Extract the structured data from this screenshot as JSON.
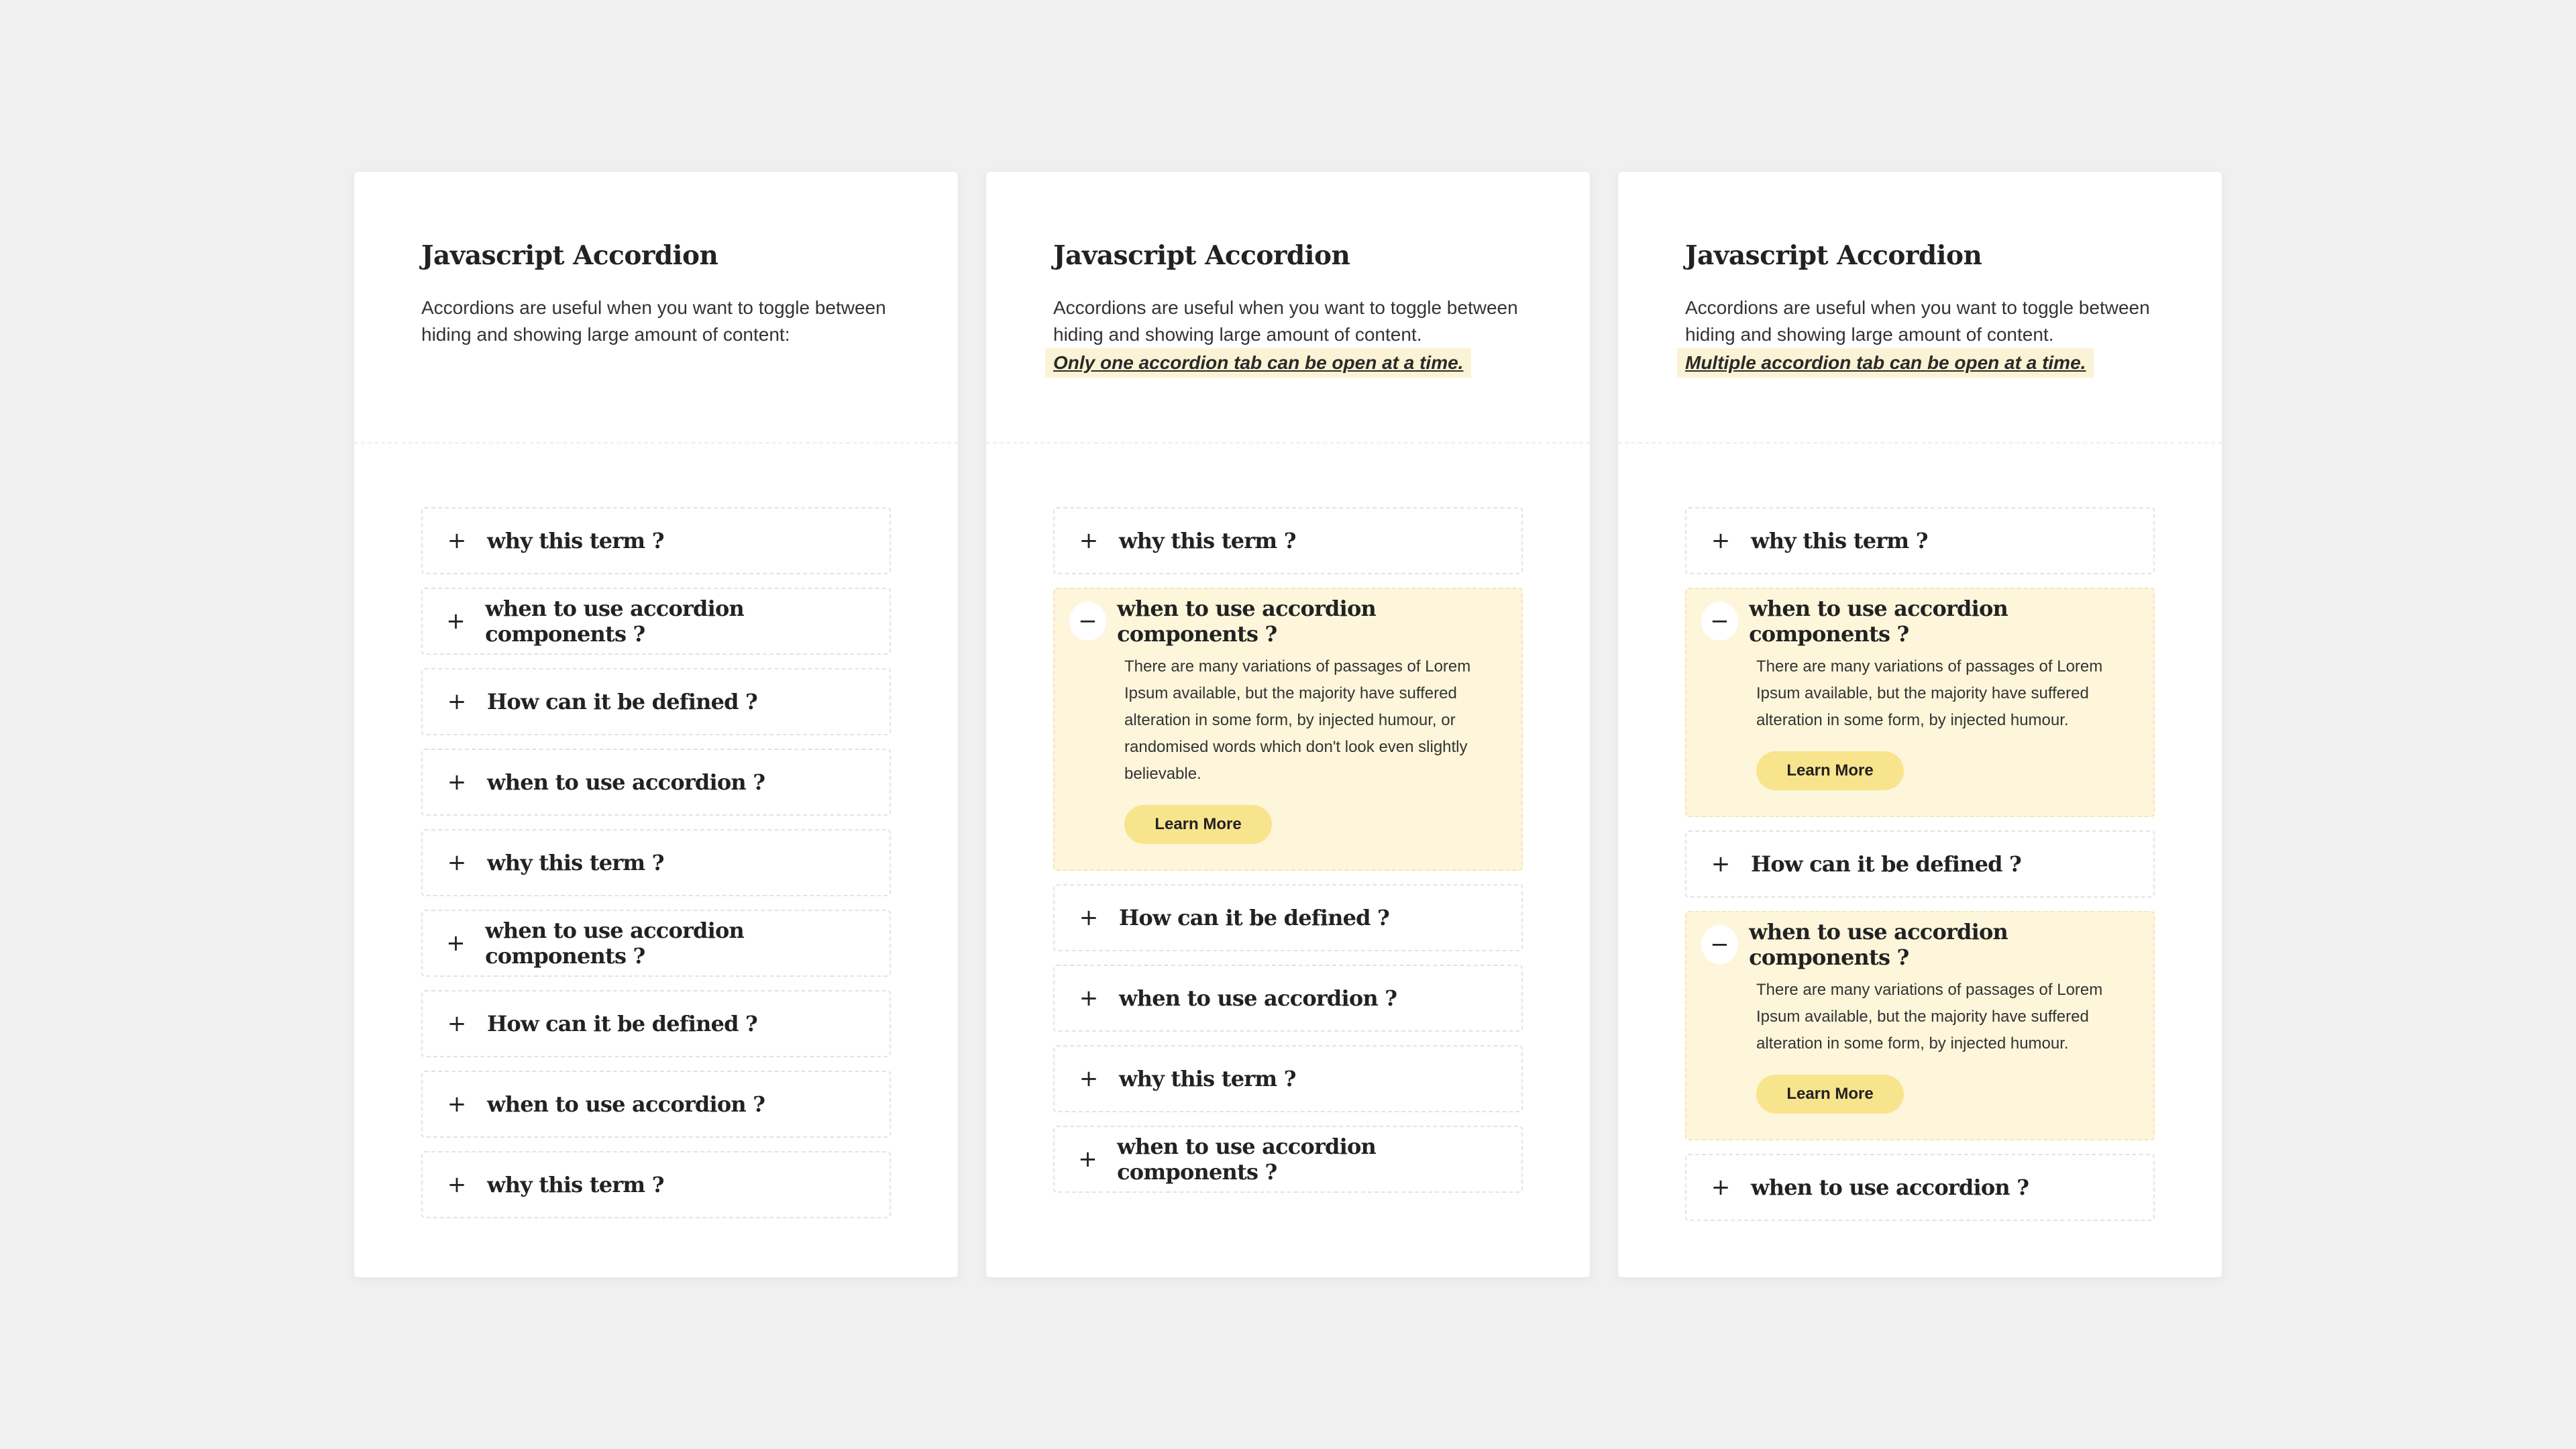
{
  "colors": {
    "background": "#f0f0f0",
    "card": "#ffffff",
    "open_item_bg": "#fdf6db",
    "button_bg": "#f8e48d",
    "note_highlight": "#fbf3d5"
  },
  "cards": [
    {
      "title": "Javascript Accordion",
      "description": "Accordions are useful when you want to toggle between hiding and showing large amount of content:",
      "note": "",
      "items": [
        {
          "question": "why this term ?",
          "icon": "plus-icon",
          "open": false
        },
        {
          "question": "when to use accordion components ?",
          "icon": "plus-icon",
          "open": false
        },
        {
          "question": "How can it be defined ?",
          "icon": "plus-icon",
          "open": false
        },
        {
          "question": "when to use accordion ?",
          "icon": "plus-icon",
          "open": false
        },
        {
          "question": "why this term ?",
          "icon": "plus-icon",
          "open": false
        },
        {
          "question": "when to use accordion components ?",
          "icon": "plus-icon",
          "open": false
        },
        {
          "question": "How can it be defined ?",
          "icon": "plus-icon",
          "open": false
        },
        {
          "question": "when to use accordion ?",
          "icon": "plus-icon",
          "open": false
        },
        {
          "question": "why this term ?",
          "icon": "plus-icon",
          "open": false
        }
      ]
    },
    {
      "title": "Javascript Accordion",
      "description": "Accordions are useful when you want to toggle between hiding and showing large amount of content.",
      "note": "Only one accordion tab can be open at a time.",
      "items": [
        {
          "question": "why this term ?",
          "icon": "plus-icon",
          "open": false
        },
        {
          "question": "when to use accordion components ?",
          "icon": "minus-icon",
          "open": true,
          "answer": "There are many variations of passages of Lorem Ipsum available, but the majority have suffered alteration in some form, by injected humour, or randomised words which don't look even slightly believable.",
          "button": "Learn More"
        },
        {
          "question": "How can it be defined ?",
          "icon": "plus-icon",
          "open": false
        },
        {
          "question": "when to use accordion ?",
          "icon": "plus-icon",
          "open": false
        },
        {
          "question": "why this term ?",
          "icon": "plus-icon",
          "open": false
        },
        {
          "question": "when to use accordion components ?",
          "icon": "plus-icon",
          "open": false
        }
      ]
    },
    {
      "title": "Javascript Accordion",
      "description": "Accordions are useful when you want to toggle between hiding and showing large amount of content.",
      "note": "Multiple accordion tab can be open at a time.",
      "items": [
        {
          "question": "why this term ?",
          "icon": "plus-icon",
          "open": false
        },
        {
          "question": "when to use accordion components ?",
          "icon": "minus-icon",
          "open": true,
          "answer": "There are many variations of passages of Lorem Ipsum available, but the majority have suffered alteration in some form, by injected humour.",
          "button": "Learn More"
        },
        {
          "question": "How can it be defined ?",
          "icon": "plus-icon",
          "open": false
        },
        {
          "question": "when to use accordion components ?",
          "icon": "minus-icon",
          "open": true,
          "answer": "There are many variations of passages of Lorem Ipsum available, but the majority have suffered alteration in some form, by injected humour.",
          "button": "Learn More"
        },
        {
          "question": "when to use accordion ?",
          "icon": "plus-icon",
          "open": false
        }
      ]
    }
  ]
}
